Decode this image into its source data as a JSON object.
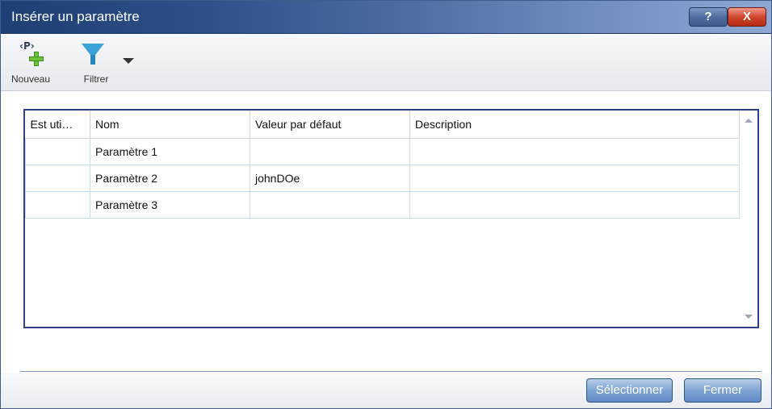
{
  "window": {
    "title": "Insérer un paramètre",
    "help_button": "?",
    "close_button": "X"
  },
  "toolbar": {
    "new_label": "Nouveau",
    "new_icon_glyph": "‹P›",
    "filter_label": "Filtrer",
    "icons": [
      "parameter-add-icon",
      "funnel-filter-icon",
      "dropdown-arrow-icon"
    ]
  },
  "table": {
    "columns": [
      "Est uti…",
      "Nom",
      "Valeur par défaut",
      "Description"
    ],
    "rows": [
      {
        "used": "",
        "name": "Paramètre 1",
        "default": "",
        "description": ""
      },
      {
        "used": "",
        "name": "Paramètre 2",
        "default": "johnDOe",
        "description": ""
      },
      {
        "used": "",
        "name": "Paramètre 3",
        "default": "",
        "description": ""
      }
    ]
  },
  "footer": {
    "select_button": "Sélectionner",
    "close_button": "Fermer"
  },
  "colors": {
    "title_bar_start": "#1e3f73",
    "title_bar_end": "#8ea8d2",
    "grid_border": "#2f3e8c",
    "row_border": "#c6def2",
    "button_blue": "#7ea4d4",
    "close_red": "#d1452c"
  }
}
